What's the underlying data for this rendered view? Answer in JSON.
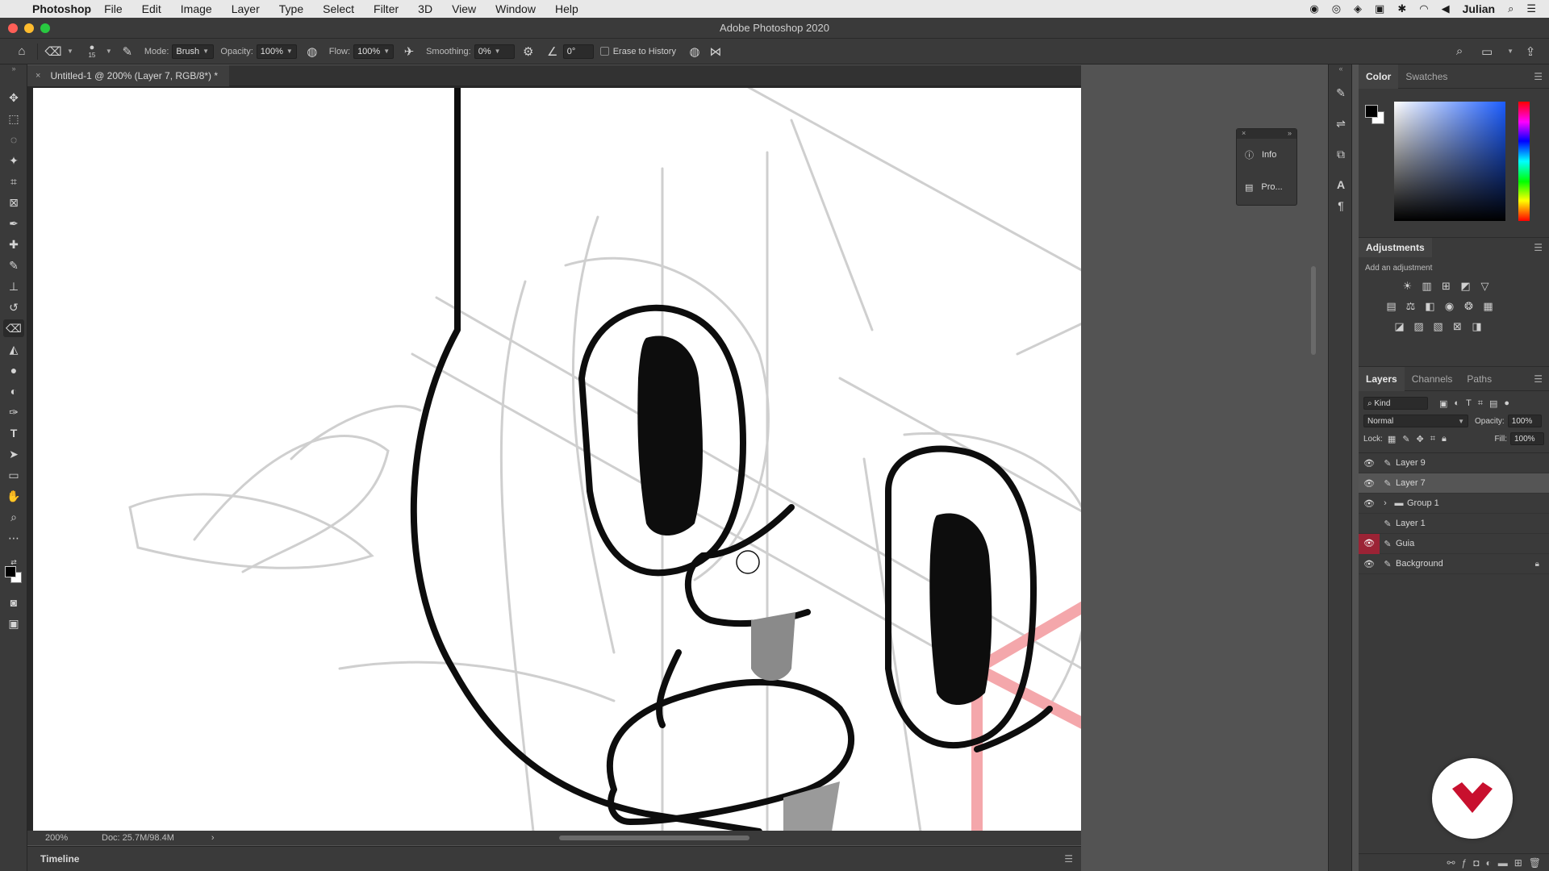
{
  "menubar": {
    "app_name": "Photoshop",
    "menus": [
      "File",
      "Edit",
      "Image",
      "Layer",
      "Type",
      "Select",
      "Filter",
      "3D",
      "View",
      "Window",
      "Help"
    ],
    "user": "Julian"
  },
  "window": {
    "title": "Adobe Photoshop 2020"
  },
  "options": {
    "brush_size": "15",
    "mode_label": "Mode:",
    "mode_value": "Brush",
    "opacity_label": "Opacity:",
    "opacity_value": "100%",
    "flow_label": "Flow:",
    "flow_value": "100%",
    "smoothing_label": "Smoothing:",
    "smoothing_value": "0%",
    "angle_value": "0°",
    "erase_history_label": "Erase to History"
  },
  "document": {
    "tab_label": "Untitled-1 @ 200% (Layer 7, RGB/8*) *",
    "zoom": "200%",
    "doc_size": "Doc: 25.7M/98.4M"
  },
  "timeline": {
    "label": "Timeline"
  },
  "float_panel": {
    "info_label": "Info",
    "properties_label": "Pro..."
  },
  "color_panel": {
    "tabs": [
      "Color",
      "Swatches"
    ],
    "foreground": "#000000",
    "background": "#ffffff"
  },
  "adjustments": {
    "title": "Adjustments",
    "subtitle": "Add an adjustment"
  },
  "layers_panel": {
    "tabs": [
      "Layers",
      "Channels",
      "Paths"
    ],
    "filter_label": "Kind",
    "blend_mode": "Normal",
    "opacity_label": "Opacity:",
    "opacity_value": "100%",
    "lock_label": "Lock:",
    "fill_label": "Fill:",
    "fill_value": "100%",
    "layers": [
      {
        "name": "Layer 9",
        "visible": true,
        "selected": false
      },
      {
        "name": "Layer 7",
        "visible": true,
        "selected": true
      },
      {
        "name": "Group 1",
        "visible": true,
        "selected": false
      },
      {
        "name": "Layer 1",
        "visible": false,
        "selected": false
      },
      {
        "name": "Guia",
        "visible": true,
        "selected": false
      },
      {
        "name": "Background",
        "visible": true,
        "selected": false
      }
    ]
  },
  "colors": {
    "accent_red": "#9b2335",
    "guide_pink": "#f4a7ab",
    "logo_red": "#c8102e"
  }
}
